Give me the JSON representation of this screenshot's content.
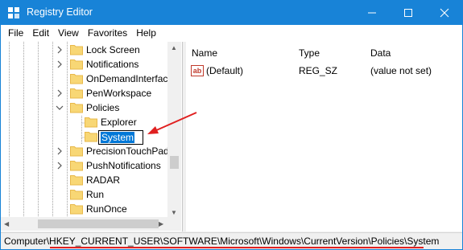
{
  "window": {
    "title": "Registry Editor",
    "accent": "#1883d7"
  },
  "menu": [
    "File",
    "Edit",
    "View",
    "Favorites",
    "Help"
  ],
  "tree": {
    "items": [
      {
        "label": "Lock Screen",
        "expander": "chevron-right",
        "selected": false
      },
      {
        "label": "Notifications",
        "expander": "chevron-right",
        "selected": false
      },
      {
        "label": "OnDemandInterfac",
        "expander": "none",
        "selected": false
      },
      {
        "label": "PenWorkspace",
        "expander": "chevron-right",
        "selected": false
      },
      {
        "label": "Policies",
        "expander": "chevron-down",
        "selected": false
      },
      {
        "label": "Explorer",
        "expander": "none",
        "selected": false
      },
      {
        "label": "System",
        "expander": "none",
        "selected": true,
        "editing": true
      },
      {
        "label": "PrecisionTouchPad",
        "expander": "chevron-right",
        "selected": false
      },
      {
        "label": "PushNotifications",
        "expander": "chevron-right",
        "selected": false
      },
      {
        "label": "RADAR",
        "expander": "none",
        "selected": false
      },
      {
        "label": "Run",
        "expander": "none",
        "selected": false
      },
      {
        "label": "RunOnce",
        "expander": "none",
        "selected": false
      }
    ]
  },
  "list": {
    "columns": [
      "Name",
      "Type",
      "Data"
    ],
    "rows": [
      {
        "icon": "ab",
        "name": "(Default)",
        "type": "REG_SZ",
        "data": "(value not set)"
      }
    ]
  },
  "status": {
    "path": "Computer\\HKEY_CURRENT_USER\\SOFTWARE\\Microsoft\\Windows\\CurrentVersion\\Policies\\System"
  },
  "colors": {
    "folder": "#f8d775",
    "folder_dark": "#e8b84a",
    "selection": "#0078d7",
    "annotation": "#e02020"
  }
}
